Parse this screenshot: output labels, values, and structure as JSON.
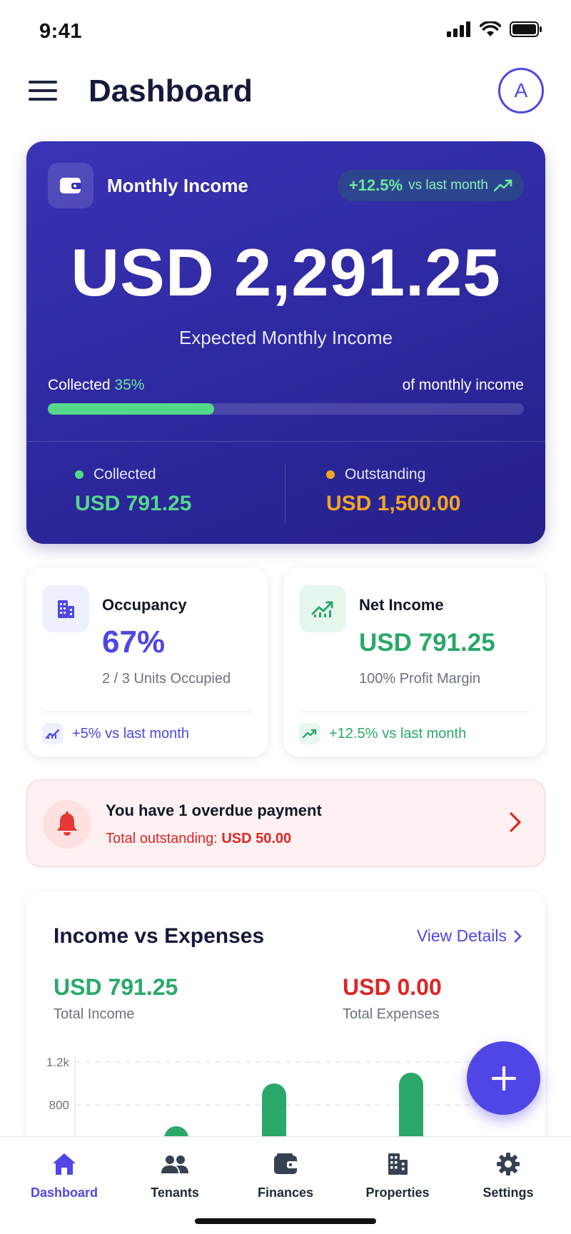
{
  "status_bar": {
    "time": "9:41"
  },
  "header": {
    "title": "Dashboard",
    "avatar_initial": "A"
  },
  "hero": {
    "label": "Monthly Income",
    "trend_value": "+12.5%",
    "trend_text": "vs last month",
    "amount": "USD 2,291.25",
    "subtitle": "Expected Monthly Income",
    "collected_label": "Collected",
    "collected_pct": "35%",
    "progress_fraction": 0.35,
    "progress_right": "of monthly income",
    "collected_stat_label": "Collected",
    "collected_stat_value": "USD 791.25",
    "outstanding_stat_label": "Outstanding",
    "outstanding_stat_value": "USD 1,500.00"
  },
  "occupancy": {
    "title": "Occupancy",
    "value": "67%",
    "desc": "2 / 3 Units Occupied",
    "footer": "+5% vs last month"
  },
  "net_income": {
    "title": "Net Income",
    "value": "USD 791.25",
    "desc": "100% Profit Margin",
    "footer_value": "+12.5%",
    "footer_text": "vs last month"
  },
  "alert": {
    "title": "You have 1 overdue payment",
    "sub_prefix": "Total outstanding:",
    "sub_amount": "USD 50.00"
  },
  "income_expenses": {
    "title": "Income vs Expenses",
    "link": "View Details",
    "income_value": "USD 791.25",
    "income_label": "Total Income",
    "expense_value": "USD 0.00",
    "expense_label": "Total Expenses"
  },
  "chart_data": {
    "type": "bar",
    "y_ticks": [
      "1.2k",
      "800"
    ],
    "y_tick_values": [
      1200,
      800
    ],
    "values": [
      600,
      1000,
      1100
    ],
    "grid": true,
    "colors": {
      "bar": "#2aa86a"
    }
  },
  "nav": {
    "items": [
      {
        "label": "Dashboard",
        "icon": "home-icon"
      },
      {
        "label": "Tenants",
        "icon": "users-icon"
      },
      {
        "label": "Finances",
        "icon": "wallet-icon"
      },
      {
        "label": "Properties",
        "icon": "building-icon"
      },
      {
        "label": "Settings",
        "icon": "gear-icon"
      }
    ]
  },
  "colors": {
    "accent": "#4f46e5",
    "green": "#2aa86a",
    "orange": "#f59e0b",
    "red": "#dc2626"
  }
}
